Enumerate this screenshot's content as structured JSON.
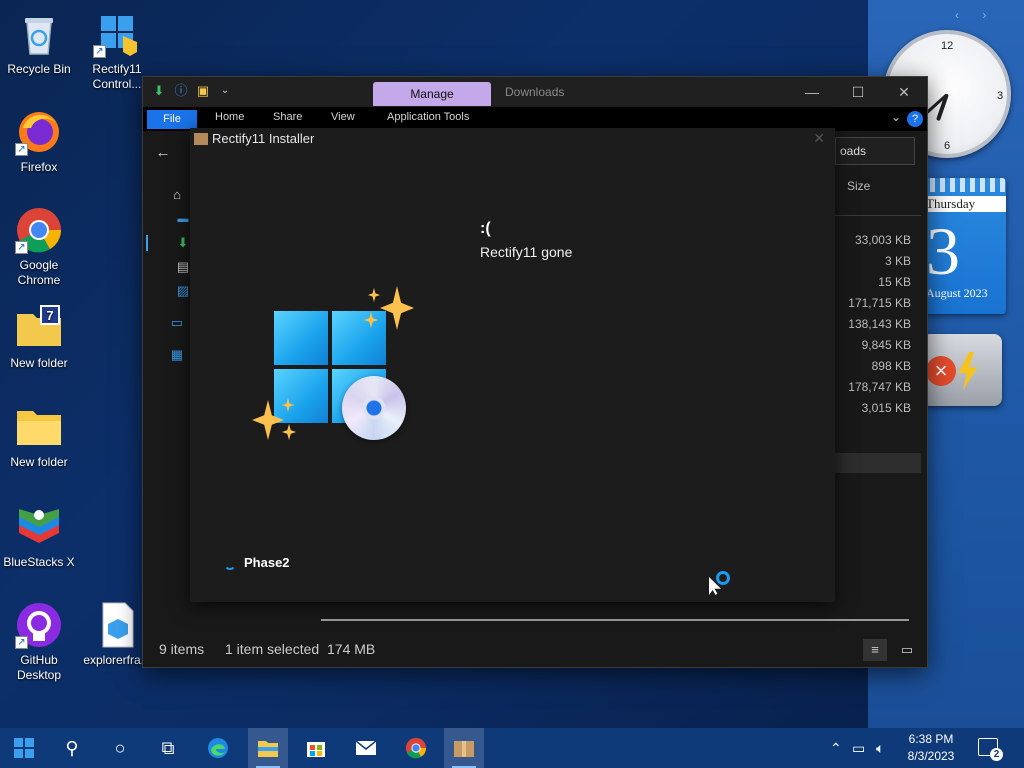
{
  "desktop": {
    "icons": [
      {
        "label": "Recycle Bin",
        "icon": "recycle-bin-icon"
      },
      {
        "label": "Rectify11 Control...",
        "icon": "rectify11-control-icon"
      },
      {
        "label": "Firefox",
        "icon": "firefox-icon"
      },
      {
        "label": "Google Chrome",
        "icon": "chrome-icon"
      },
      {
        "label": "New folder",
        "icon": "folder-icon"
      },
      {
        "label": "New folder",
        "icon": "folder-icon"
      },
      {
        "label": "BlueStacks X",
        "icon": "bluestacks-icon"
      },
      {
        "label": "GitHub Desktop",
        "icon": "github-icon"
      },
      {
        "label": "explorerfra...",
        "icon": "file-icon"
      }
    ]
  },
  "gadgets": {
    "nav": "‹ ›",
    "clock": {
      "n12": "12",
      "n3": "3",
      "n6": "6",
      "hour": 6,
      "minute": 38
    },
    "calendar": {
      "day_name": "Thursday",
      "day_number": "3",
      "month_year": "August 2023"
    },
    "battery": {
      "status": "not charging",
      "icon": "battery-icon"
    }
  },
  "explorer": {
    "title": "Downloads",
    "contextual_tab": "Manage",
    "tabs": [
      "File",
      "Home",
      "Share",
      "View",
      "Application Tools"
    ],
    "search_stub": "oads",
    "column_size": "Size",
    "sizes": [
      "33,003 KB",
      "3 KB",
      "15 KB",
      "171,715 KB",
      "138,143 KB",
      "9,845 KB",
      "898 KB",
      "178,747 KB",
      "3,015 KB"
    ],
    "status": {
      "items": "9 items",
      "selected": "1 item selected",
      "selected_size": "174 MB"
    }
  },
  "installer": {
    "title": "Rectify11 Installer",
    "sad": ":(",
    "message": "Rectify11 gone",
    "phase": "Phase2",
    "close": "✕"
  },
  "taskbar": {
    "time": "6:38 PM",
    "date": "8/3/2023",
    "notification_count": "2",
    "colors": {
      "accent": "#1a73e8",
      "taskbar": "#0f3a7a",
      "manage_tab": "#c3a8ea"
    }
  }
}
